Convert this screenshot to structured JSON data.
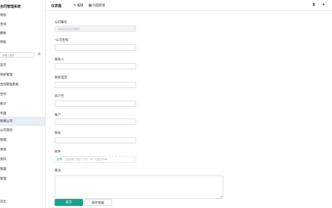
{
  "sidebar": {
    "title": "合同管理系统",
    "items": [
      {
        "label": "待办"
      },
      {
        "label": "合同"
      },
      {
        "label": "模板"
      },
      {
        "label": "审批"
      }
    ],
    "search_placeholder": "请输入搜索",
    "tree": [
      {
        "label": "首页",
        "active": false
      },
      {
        "label": "系统管理",
        "active": false
      },
      {
        "label": "合同管理系统",
        "active": false
      },
      {
        "label": "合同",
        "active": false
      },
      {
        "label": "统计",
        "active": false
      },
      {
        "label": "字典",
        "active": false
      },
      {
        "label": "新增公司",
        "active": true
      },
      {
        "label": "公司资料",
        "active": false
      },
      {
        "label": "管理",
        "active": false
      },
      {
        "label": "项目",
        "active": false
      },
      {
        "label": "资料",
        "active": false
      },
      {
        "label": "管理",
        "active": false
      },
      {
        "label": "管理",
        "active": false
      }
    ],
    "footer": "退出"
  },
  "topbar": {
    "tab_title": "仪表盘",
    "edit_label": "编辑",
    "manage_label": "页面管理"
  },
  "form": {
    "company_code": {
      "label": "公司编号",
      "placeholder": "保存后自动生成编号",
      "required": false
    },
    "company_name": {
      "label": "公司名称",
      "placeholder": "",
      "required": true
    },
    "contact": {
      "label": "联系人",
      "placeholder": "",
      "required": false
    },
    "phone": {
      "label": "联系电话",
      "placeholder": "",
      "required": false
    },
    "bank": {
      "label": "开户行",
      "placeholder": "",
      "required": false
    },
    "account": {
      "label": "账户",
      "placeholder": "",
      "required": false
    },
    "tax_no": {
      "label": "税号",
      "placeholder": "",
      "required": false
    },
    "attachment": {
      "label": "附件",
      "select_label": "选择",
      "hint": "请选择单个或多个文件，单个不超过50MB"
    },
    "remark": {
      "label": "备注"
    }
  },
  "buttons": {
    "submit": "提交",
    "save_draft": "保存草稿"
  }
}
